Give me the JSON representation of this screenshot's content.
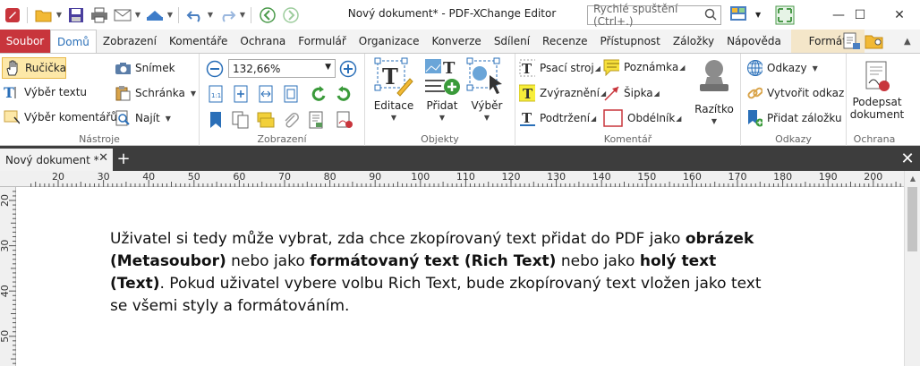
{
  "window": {
    "title": "Nový dokument* - PDF-XChange Editor",
    "quick_launch_placeholder": "Rychlé spuštění (Ctrl+.)"
  },
  "menu_tabs": [
    "Soubor",
    "Domů",
    "Zobrazení",
    "Komentáře",
    "Ochrana",
    "Formulář",
    "Organizace",
    "Konverze",
    "Sdílení",
    "Recenze",
    "Přístupnost",
    "Záložky",
    "Nápověda",
    "Formát"
  ],
  "ribbon": {
    "tools": {
      "label": "Nástroje",
      "hand": "Ručička",
      "select_text": "Výběr textu",
      "select_comments": "Výběr komentářů",
      "snapshot": "Snímek",
      "clipboard": "Schránka",
      "find": "Najít"
    },
    "view": {
      "label": "Zobrazení",
      "zoom": "132,66%"
    },
    "objects": {
      "label": "Objekty",
      "edit": "Editace",
      "add": "Přidat",
      "select": "Výběr"
    },
    "comment": {
      "label": "Komentář",
      "typewriter": "Psací stroj",
      "highlight": "Zvýraznění",
      "underline": "Podtržení",
      "note": "Poznámka",
      "arrow": "Šipka",
      "rectangle": "Obdélník",
      "stamp": "Razítko"
    },
    "links": {
      "label": "Odkazy",
      "links": "Odkazy",
      "create_link": "Vytvořit odkaz",
      "add_bookmark": "Přidat záložku"
    },
    "protect": {
      "label": "Ochrana",
      "sign": "Podepsat",
      "document": "dokument"
    }
  },
  "document_tab": {
    "title": "Nový dokument *"
  },
  "ruler": {
    "top_ticks": [
      "20",
      "30",
      "40",
      "50",
      "60",
      "70",
      "80",
      "90",
      "100",
      "110",
      "120",
      "130",
      "140",
      "150",
      "160",
      "170",
      "180",
      "190",
      "200"
    ],
    "left_ticks": [
      "20",
      "30",
      "40",
      "50"
    ]
  },
  "content": {
    "t1": "Uživatel si tedy může vybrat, zda chce zkopírovaný text přidat do PDF jako ",
    "b1": "obrázek (Metasoubor)",
    "t2": " nebo jako ",
    "b2": "formátovaný text (Rich Text)",
    "t3": " nebo jako ",
    "b3": "holý text (Text)",
    "t4": ". Pokud uživatel vybere volbu Rich Text, bude zkopírovaný text vložen jako text se všemi styly a formátováním."
  },
  "colors": {
    "file_tab": "#c8353c",
    "active_tab_text": "#2a6fb8",
    "format_tab": "#f4e6c9",
    "hand_highlight": "#fde8a8",
    "doc_tabbar": "#3d3d3d"
  }
}
